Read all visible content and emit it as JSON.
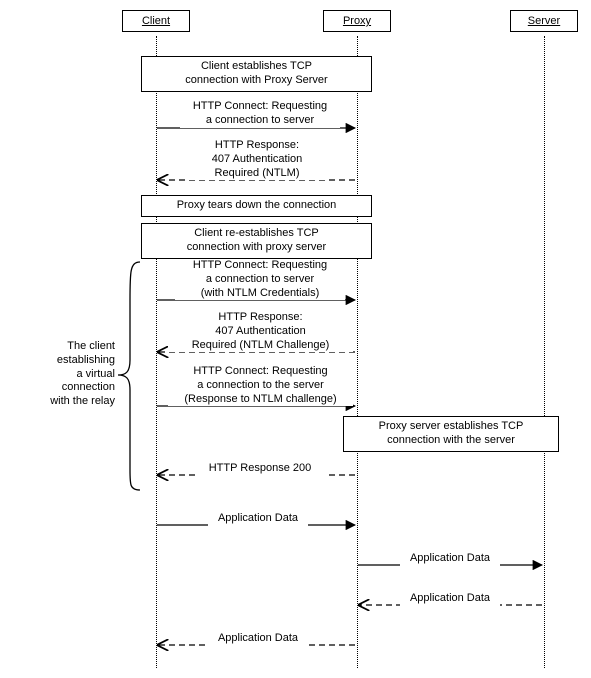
{
  "participants": {
    "client": "Client",
    "proxy": "Proxy",
    "server": "Server"
  },
  "boxes": {
    "b1": "Client establishes TCP\nconnection with Proxy Server",
    "b2": "Proxy tears down the connection",
    "b3": "Client re-establishes TCP\nconnection with proxy server",
    "b4": "Proxy server establishes TCP\nconnection with the server"
  },
  "messages": {
    "m1": "HTTP Connect: Requesting\na connection to server",
    "m2": "HTTP Response:\n407 Authentication\nRequired (NTLM)",
    "m3": "HTTP Connect: Requesting\na connection to server\n(with NTLM Credentials)",
    "m4": "HTTP Response:\n407 Authentication\nRequired (NTLM Challenge)",
    "m5": "HTTP Connect: Requesting\na connection to the server\n(Response to NTLM challenge)",
    "m6": "HTTP Response 200",
    "m7": "Application Data",
    "m8": "Application Data",
    "m9": "Application Data",
    "m10": "Application Data"
  },
  "sideNote": "The client\nestablishing\na virtual\nconnection\nwith the relay",
  "chart_data": {
    "type": "sequence-diagram",
    "participants": [
      "Client",
      "Proxy",
      "Server"
    ],
    "steps": [
      {
        "kind": "note",
        "over": [
          "Client",
          "Proxy"
        ],
        "text": "Client establishes TCP connection with Proxy Server"
      },
      {
        "kind": "message",
        "from": "Client",
        "to": "Proxy",
        "style": "solid",
        "text": "HTTP Connect: Requesting a connection to server"
      },
      {
        "kind": "message",
        "from": "Proxy",
        "to": "Client",
        "style": "dashed",
        "text": "HTTP Response: 407 Authentication Required (NTLM)"
      },
      {
        "kind": "note",
        "over": [
          "Client",
          "Proxy"
        ],
        "text": "Proxy tears down the connection"
      },
      {
        "kind": "note",
        "over": [
          "Client",
          "Proxy"
        ],
        "text": "Client re-establishes TCP connection with proxy server"
      },
      {
        "kind": "message",
        "from": "Client",
        "to": "Proxy",
        "style": "solid",
        "text": "HTTP Connect: Requesting a connection to server (with NTLM Credentials)"
      },
      {
        "kind": "message",
        "from": "Proxy",
        "to": "Client",
        "style": "dashed",
        "text": "HTTP Response: 407 Authentication Required (NTLM Challenge)"
      },
      {
        "kind": "message",
        "from": "Client",
        "to": "Proxy",
        "style": "solid",
        "text": "HTTP Connect: Requesting a connection to the server (Response to NTLM challenge)"
      },
      {
        "kind": "note",
        "over": [
          "Proxy",
          "Server"
        ],
        "text": "Proxy server establishes TCP connection with the server"
      },
      {
        "kind": "message",
        "from": "Proxy",
        "to": "Client",
        "style": "dashed",
        "text": "HTTP Response 200"
      },
      {
        "kind": "message",
        "from": "Client",
        "to": "Proxy",
        "style": "solid",
        "text": "Application Data"
      },
      {
        "kind": "message",
        "from": "Proxy",
        "to": "Server",
        "style": "solid",
        "text": "Application Data"
      },
      {
        "kind": "message",
        "from": "Server",
        "to": "Proxy",
        "style": "dashed",
        "text": "Application Data"
      },
      {
        "kind": "message",
        "from": "Proxy",
        "to": "Client",
        "style": "dashed",
        "text": "Application Data"
      }
    ],
    "sideAnnotation": {
      "text": "The client establishing a virtual connection with the relay",
      "spansSteps": [
        5,
        6,
        7,
        8,
        9
      ]
    }
  }
}
